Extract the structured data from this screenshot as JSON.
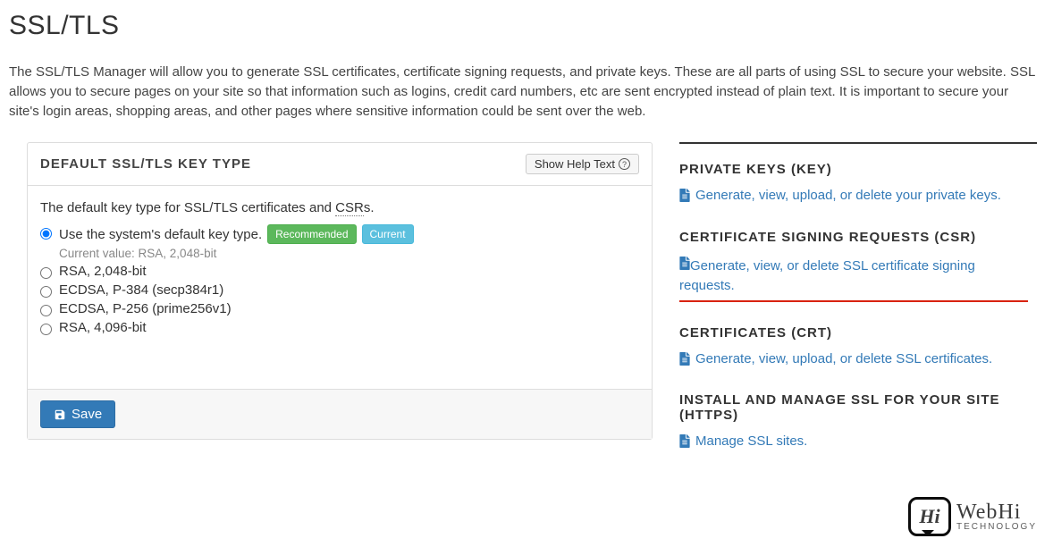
{
  "title": "SSL/TLS",
  "intro": "The SSL/TLS Manager will allow you to generate SSL certificates, certificate signing requests, and private keys. These are all parts of using SSL to secure your website. SSL allows you to secure pages on your site so that information such as logins, credit card numbers, etc are sent encrypted instead of plain text. It is important to secure your site's login areas, shopping areas, and other pages where sensitive information could be sent over the web.",
  "panel": {
    "heading": "DEFAULT SSL/TLS KEY TYPE",
    "help_btn": "Show Help Text",
    "desc_a": "The default key type for SSL/TLS certificates and ",
    "desc_csr": "CSR",
    "desc_b": "s.",
    "options": [
      {
        "label": "Use the system's default key type.",
        "checked": true,
        "badges": [
          "Recommended",
          "Current"
        ],
        "sub": "Current value: RSA, 2,048-bit"
      },
      {
        "label": "RSA, 2,048-bit",
        "checked": false
      },
      {
        "label": "ECDSA, P-384 (secp384r1)",
        "checked": false
      },
      {
        "label": "ECDSA, P-256 (prime256v1)",
        "checked": false
      },
      {
        "label": "RSA, 4,096-bit",
        "checked": false
      }
    ],
    "save": "Save"
  },
  "sections": [
    {
      "heading": "PRIVATE KEYS (KEY)",
      "link": "Generate, view, upload, or delete your private keys.",
      "highlighted": false
    },
    {
      "heading": "CERTIFICATE SIGNING REQUESTS (CSR)",
      "link": "Generate, view, or delete SSL certificate signing requests.",
      "highlighted": true
    },
    {
      "heading": "CERTIFICATES (CRT)",
      "link": "Generate, view, upload, or delete SSL certificates.",
      "highlighted": false
    },
    {
      "heading": "INSTALL AND MANAGE SSL FOR YOUR SITE (HTTPS)",
      "link": "Manage SSL sites.",
      "highlighted": false
    }
  ],
  "watermark": {
    "bubble": "Hi",
    "top": "WebHi",
    "bot": "TECHNOLOGY"
  }
}
